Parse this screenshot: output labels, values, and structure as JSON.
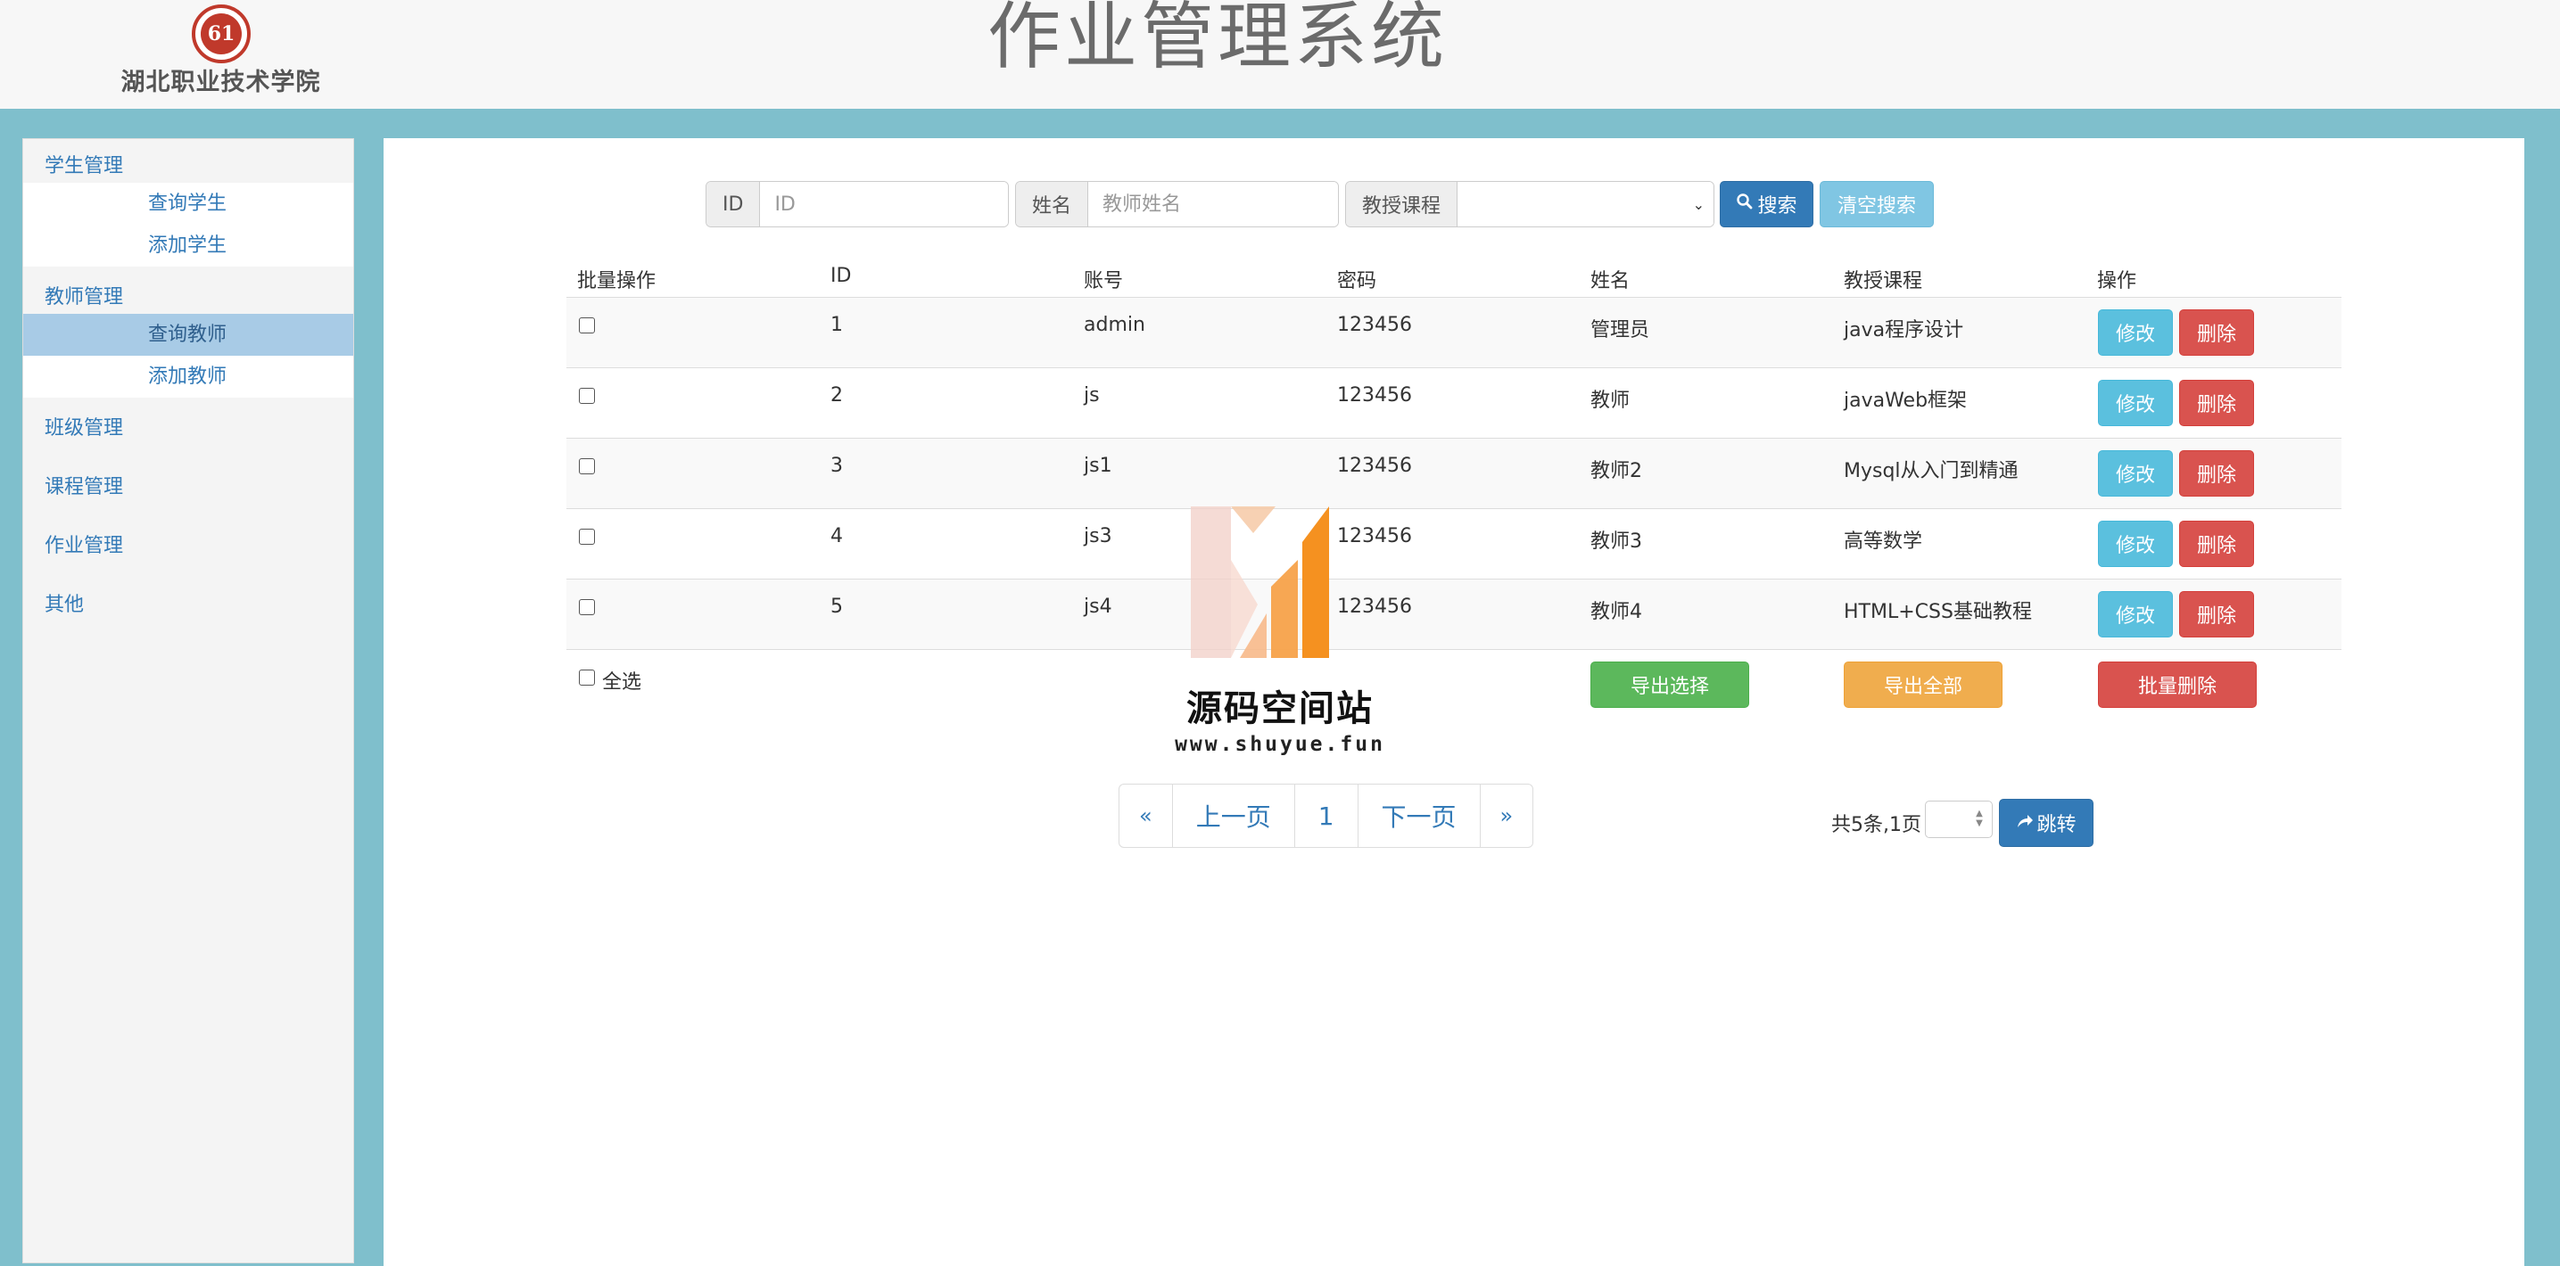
{
  "header": {
    "school_name": "湖北职业技术学院",
    "logo_text": "61",
    "app_title": "作业管理系统"
  },
  "sidebar": {
    "groups": [
      {
        "label": "学生管理",
        "items": [
          "查询学生",
          "添加学生"
        ]
      },
      {
        "label": "教师管理",
        "items": [
          "查询教师",
          "添加教师"
        ],
        "active_item": "查询教师"
      },
      {
        "label": "班级管理"
      },
      {
        "label": "课程管理"
      },
      {
        "label": "作业管理"
      },
      {
        "label": "其他"
      }
    ]
  },
  "search": {
    "id_label": "ID",
    "id_placeholder": "ID",
    "name_label": "姓名",
    "name_placeholder": "教师姓名",
    "course_label": "教授课程",
    "course_selected": "",
    "search_button": "搜索",
    "clear_button": "清空搜索"
  },
  "table": {
    "headers": [
      "批量操作",
      "ID",
      "账号",
      "密码",
      "姓名",
      "教授课程",
      "操作"
    ],
    "rows": [
      {
        "id": "1",
        "account": "admin",
        "password": "123456",
        "name": "管理员",
        "course": "java程序设计"
      },
      {
        "id": "2",
        "account": "js",
        "password": "123456",
        "name": "教师",
        "course": "javaWeb框架"
      },
      {
        "id": "3",
        "account": "js1",
        "password": "123456",
        "name": "教师2",
        "course": "Mysql从入门到精通"
      },
      {
        "id": "4",
        "account": "js3",
        "password": "123456",
        "name": "教师3",
        "course": "高等数学"
      },
      {
        "id": "5",
        "account": "js4",
        "password": "123456",
        "name": "教师4",
        "course": "HTML+CSS基础教程"
      }
    ],
    "edit_label": "修改",
    "delete_label": "删除",
    "select_all_label": "全选",
    "export_selected_label": "导出选择",
    "export_all_label": "导出全部",
    "batch_delete_label": "批量删除"
  },
  "pagination": {
    "first": "«",
    "prev": "上一页",
    "current": "1",
    "next": "下一页",
    "last": "»",
    "info": "共5条,1页",
    "jump_label": "跳转"
  },
  "watermark": {
    "title": "源码空间站",
    "url": "www.shuyue.fun"
  },
  "colors": {
    "frame": "#7fbfcc",
    "link": "#337ab7",
    "active_menu": "#a8cbe6"
  }
}
